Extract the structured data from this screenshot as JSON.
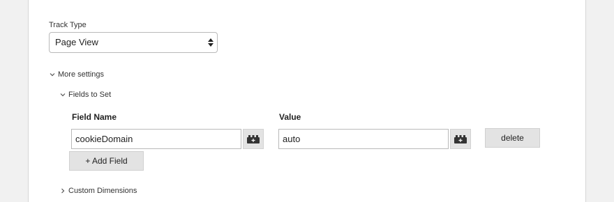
{
  "track_type": {
    "label": "Track Type",
    "selected": "Page View"
  },
  "more_settings": {
    "label": "More settings",
    "expanded": true
  },
  "fields_to_set": {
    "label": "Fields to Set",
    "expanded": true,
    "columns": {
      "name": "Field Name",
      "value": "Value"
    },
    "rows": [
      {
        "name": "cookieDomain",
        "value": "auto",
        "delete_label": "delete"
      }
    ],
    "add_label": "+ Add Field"
  },
  "custom_dimensions": {
    "label": "Custom Dimensions",
    "expanded": false
  },
  "icons": {
    "variable_picker": "variable-block-icon",
    "expanded": "chevron-down-icon",
    "collapsed": "chevron-right-icon",
    "select": "select-arrows-icon"
  }
}
